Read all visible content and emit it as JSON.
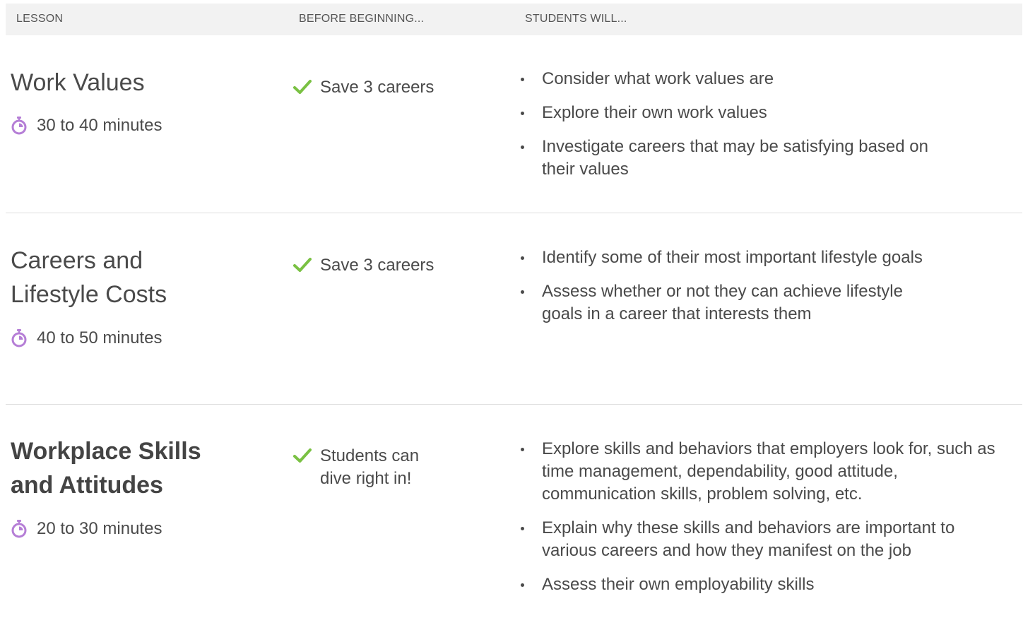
{
  "header": {
    "lesson_label": "LESSON",
    "before_label": "BEFORE BEGINNING...",
    "students_label": "STUDENTS WILL..."
  },
  "colors": {
    "header_bg": "#f2f2f2",
    "check": "#7ac143",
    "stopwatch": "#b57ed6",
    "divider": "#dddddd",
    "text": "#4a4a4a"
  },
  "lessons": [
    {
      "title": "Work Values",
      "duration": "30 to 40 minutes",
      "prereq": "Save 3 careers",
      "outcomes": [
        "Consider what work values are",
        "Explore their own work values",
        "Investigate careers that may be satisfying based on their values"
      ]
    },
    {
      "title": "Careers and Lifestyle Costs",
      "duration": "40 to 50 minutes",
      "prereq": "Save 3 careers",
      "outcomes": [
        "Identify some of their most important lifestyle goals",
        "Assess whether or not they can achieve lifestyle goals in a career that interests them"
      ]
    },
    {
      "title": "Workplace Skills and Attitudes",
      "duration": "20 to 30 minutes",
      "prereq": "Students can dive right in!",
      "outcomes": [
        "Explore skills and behaviors that employers look for, such as time management, dependability, good attitude, communication skills, problem solving, etc.",
        "Explain why these skills and behaviors are important to various careers and how they manifest on the job",
        "Assess their own employability skills"
      ]
    }
  ]
}
